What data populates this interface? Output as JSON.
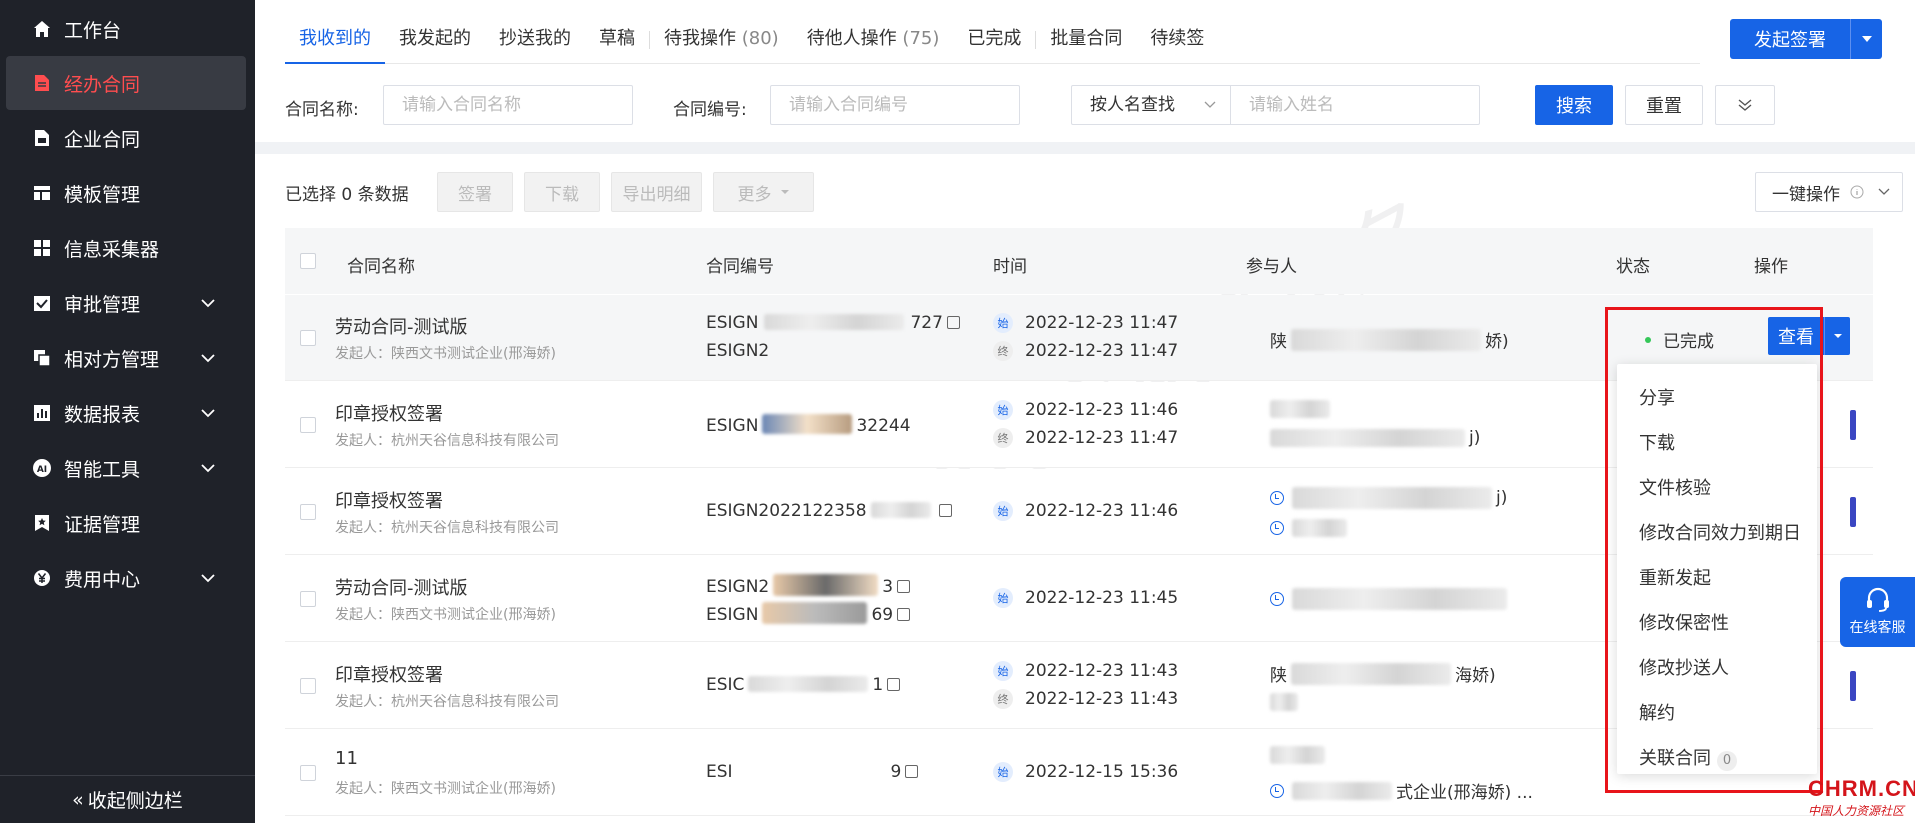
{
  "sidebar": {
    "items": [
      {
        "label": "工作台",
        "icon": "home-icon",
        "expandable": false
      },
      {
        "label": "经办合同",
        "icon": "document-icon",
        "expandable": false,
        "active": true
      },
      {
        "label": "企业合同",
        "icon": "file-icon",
        "expandable": false
      },
      {
        "label": "模板管理",
        "icon": "layout-icon",
        "expandable": false
      },
      {
        "label": "信息采集器",
        "icon": "grid-icon",
        "expandable": false
      },
      {
        "label": "审批管理",
        "icon": "check-square-icon",
        "expandable": true
      },
      {
        "label": "相对方管理",
        "icon": "copy-icon",
        "expandable": true
      },
      {
        "label": "数据报表",
        "icon": "bar-chart-icon",
        "expandable": true
      },
      {
        "label": "智能工具",
        "icon": "ai-icon",
        "expandable": true
      },
      {
        "label": "证据管理",
        "icon": "bookmark-icon",
        "expandable": false
      },
      {
        "label": "费用中心",
        "icon": "yen-icon",
        "expandable": true
      }
    ],
    "collapse_label": "收起侧边栏"
  },
  "tabs": [
    {
      "label": "我收到的",
      "active": true
    },
    {
      "label": "我发起的"
    },
    {
      "label": "抄送我的"
    },
    {
      "label": "草稿"
    },
    {
      "label": "待我操作",
      "count": "(80)"
    },
    {
      "label": "待他人操作",
      "count": "(75)"
    },
    {
      "label": "已完成"
    },
    {
      "label": "批量合同"
    },
    {
      "label": "待续签"
    }
  ],
  "primary_action": "发起签署",
  "filters": {
    "name_label": "合同名称:",
    "name_placeholder": "请输入合同名称",
    "no_label": "合同编号:",
    "no_placeholder": "请输入合同编号",
    "search_by": "按人名查找",
    "person_placeholder": "请输入姓名",
    "search_btn": "搜索",
    "reset_btn": "重置"
  },
  "toolbar": {
    "selected": "已选择 0 条数据",
    "sign": "签署",
    "download": "下载",
    "export": "导出明细",
    "more": "更多",
    "one_key": "一键操作"
  },
  "table": {
    "headers": [
      "合同名称",
      "合同编号",
      "时间",
      "参与人",
      "状态",
      "操作"
    ],
    "rows": [
      {
        "name": "劳动合同-测试版",
        "sponsor": "发起人：陕西文书测试企业(邢海娇)",
        "nos": [
          "ESIGN",
          "ESIGN2"
        ],
        "nos_tail": [
          "727",
          ""
        ],
        "times": [
          {
            "k": "始",
            "v": "2022-12-23 11:47"
          },
          {
            "k": "终",
            "v": "2022-12-23 11:47"
          }
        ],
        "party_start": "陕",
        "party_end": "娇)",
        "status": "已完成",
        "view": "查看"
      },
      {
        "name": "印章授权签署",
        "sponsor": "发起人：杭州天谷信息科技有限公司",
        "nos": [
          "ESIGN"
        ],
        "nos_tail": [
          "32244"
        ],
        "times": [
          {
            "k": "始",
            "v": "2022-12-23 11:46"
          },
          {
            "k": "终",
            "v": "2022-12-23 11:47"
          }
        ],
        "party_start": "",
        "party_end": "j)"
      },
      {
        "name": "印章授权签署",
        "sponsor": "发起人：杭州天谷信息科技有限公司",
        "nos": [
          "ESIGN2022122358"
        ],
        "nos_tail": [
          ""
        ],
        "times": [
          {
            "k": "始",
            "v": "2022-12-23 11:46"
          }
        ],
        "party_start": "",
        "party_end": "j)"
      },
      {
        "name": "劳动合同-测试版",
        "sponsor": "发起人：陕西文书测试企业(邢海娇)",
        "nos": [
          "ESIGN2",
          "ESIGN"
        ],
        "nos_tail": [
          "3",
          "69"
        ],
        "times": [
          {
            "k": "始",
            "v": "2022-12-23 11:45"
          }
        ],
        "party_start": "",
        "party_end": ""
      },
      {
        "name": "印章授权签署",
        "sponsor": "发起人：杭州天谷信息科技有限公司",
        "nos": [
          "ESIC"
        ],
        "nos_tail": [
          "1"
        ],
        "times": [
          {
            "k": "始",
            "v": "2022-12-23 11:43"
          },
          {
            "k": "终",
            "v": "2022-12-23 11:43"
          }
        ],
        "party_start": "陕",
        "party_end": "海娇)"
      },
      {
        "name": "11",
        "sponsor": "发起人：陕西文书测试企业(邢海娇)",
        "nos": [
          "ESI"
        ],
        "nos_tail": [
          "9"
        ],
        "times": [
          {
            "k": "始",
            "v": "2022-12-15 15:36"
          }
        ],
        "party_start": "",
        "party_end": "式企业(邢海娇) ..."
      }
    ]
  },
  "dropdown": {
    "items": [
      "分享",
      "下载",
      "文件核验",
      "修改合同效力到期日",
      "重新发起",
      "修改保密性",
      "修改抄送人",
      "解约",
      "关联合同"
    ],
    "related_count": "0"
  },
  "service_label": "在线客服",
  "watermark": "e签宝电子签名",
  "logo": {
    "main": "CHRM.CN",
    "sub": "中国人力资源社区"
  },
  "colors": {
    "primary": "#1764e6",
    "sidebar": "#1f2229",
    "active_nav": "#ff4d4f",
    "status_done": "#35c759",
    "highlight_frame": "#e8141a"
  }
}
